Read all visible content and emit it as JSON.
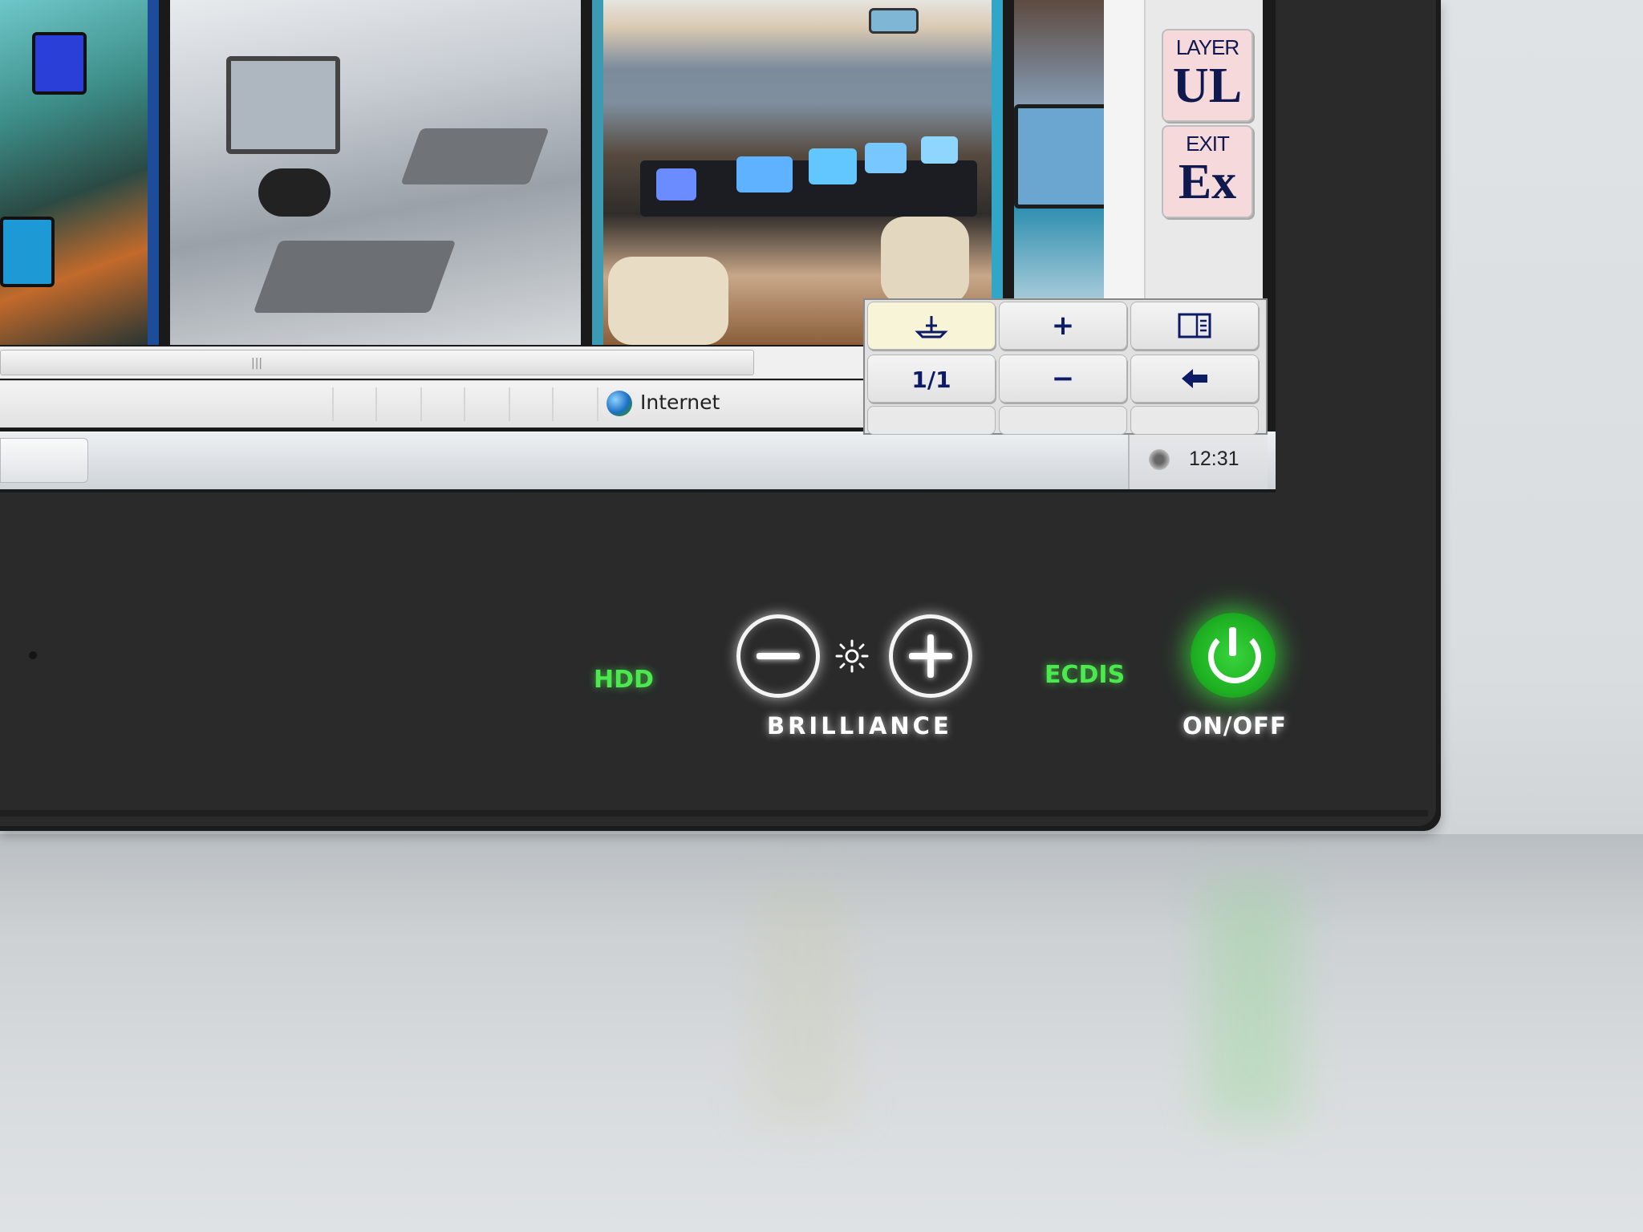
{
  "window": {
    "status_zone": "Internet",
    "clock": "12:31"
  },
  "side_panel": {
    "layer_button": {
      "small_label": "LAYER",
      "big_label": "UL"
    },
    "exit_button": {
      "small_label": "EXIT",
      "big_label": "Ex"
    }
  },
  "keypad": {
    "keys": [
      {
        "label": "⛴",
        "icon": "ship-icon"
      },
      {
        "label": "+",
        "icon": "zoom-in"
      },
      {
        "label": "◫",
        "icon": "panel-icon"
      },
      {
        "label": "1/1",
        "icon": "scale-icon"
      },
      {
        "label": "−",
        "icon": "zoom-out"
      },
      {
        "label": "🡄",
        "icon": "back-arrow-icon"
      }
    ]
  },
  "bezel": {
    "hdd_label": "HDD",
    "ecdis_label": "ECDIS",
    "brilliance_label": "BRILLIANCE",
    "power_label": "ON/OFF"
  },
  "colors": {
    "led_green": "#4be84e",
    "bezel": "#2a2a2b",
    "button_pink": "#f6d9db",
    "keypad_text": "#0d1a66"
  }
}
